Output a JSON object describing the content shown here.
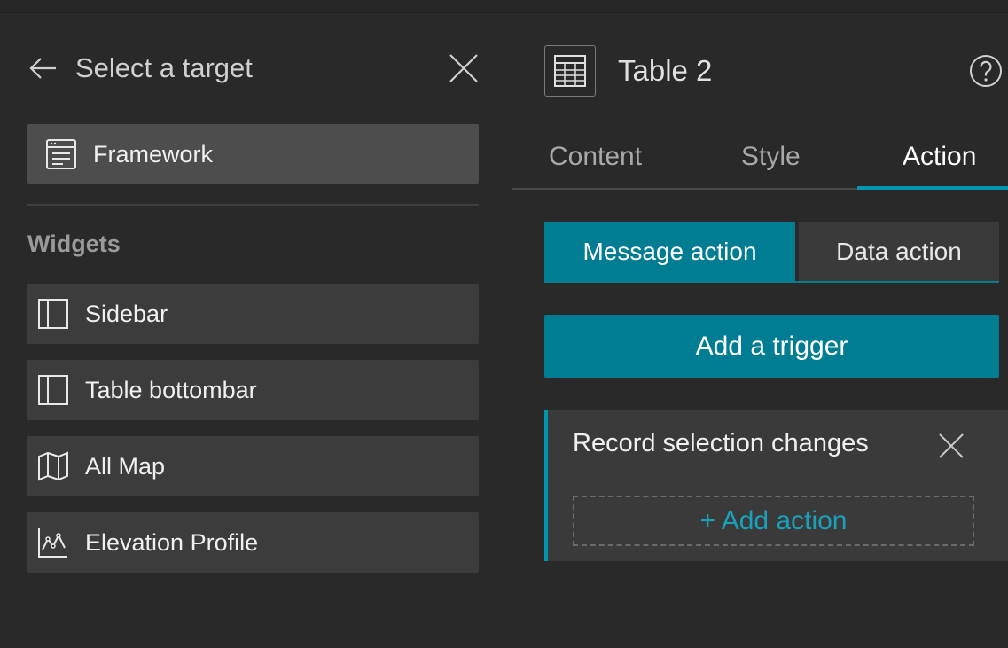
{
  "left_panel": {
    "title": "Select a target",
    "framework_label": "Framework",
    "section_label": "Widgets",
    "widgets": [
      {
        "label": "Sidebar",
        "icon": "sidebar-layout-icon"
      },
      {
        "label": "Table bottombar",
        "icon": "sidebar-layout-icon"
      },
      {
        "label": "All Map",
        "icon": "map-icon"
      },
      {
        "label": "Elevation Profile",
        "icon": "elevation-profile-icon"
      }
    ]
  },
  "right_panel": {
    "title": "Table 2",
    "tabs": [
      {
        "label": "Content"
      },
      {
        "label": "Style"
      },
      {
        "label": "Action"
      }
    ],
    "segment": {
      "message_label": "Message action",
      "data_label": "Data action"
    },
    "add_trigger_label": "Add a trigger",
    "trigger": {
      "name": "Record selection changes",
      "add_action_label": "+ Add action"
    }
  },
  "colors": {
    "accent": "#007c93",
    "accent_light": "#1aa0b8",
    "panel_bg": "#292929",
    "item_bg": "#3c3c3c",
    "item_selected_bg": "#4d4d4d"
  }
}
